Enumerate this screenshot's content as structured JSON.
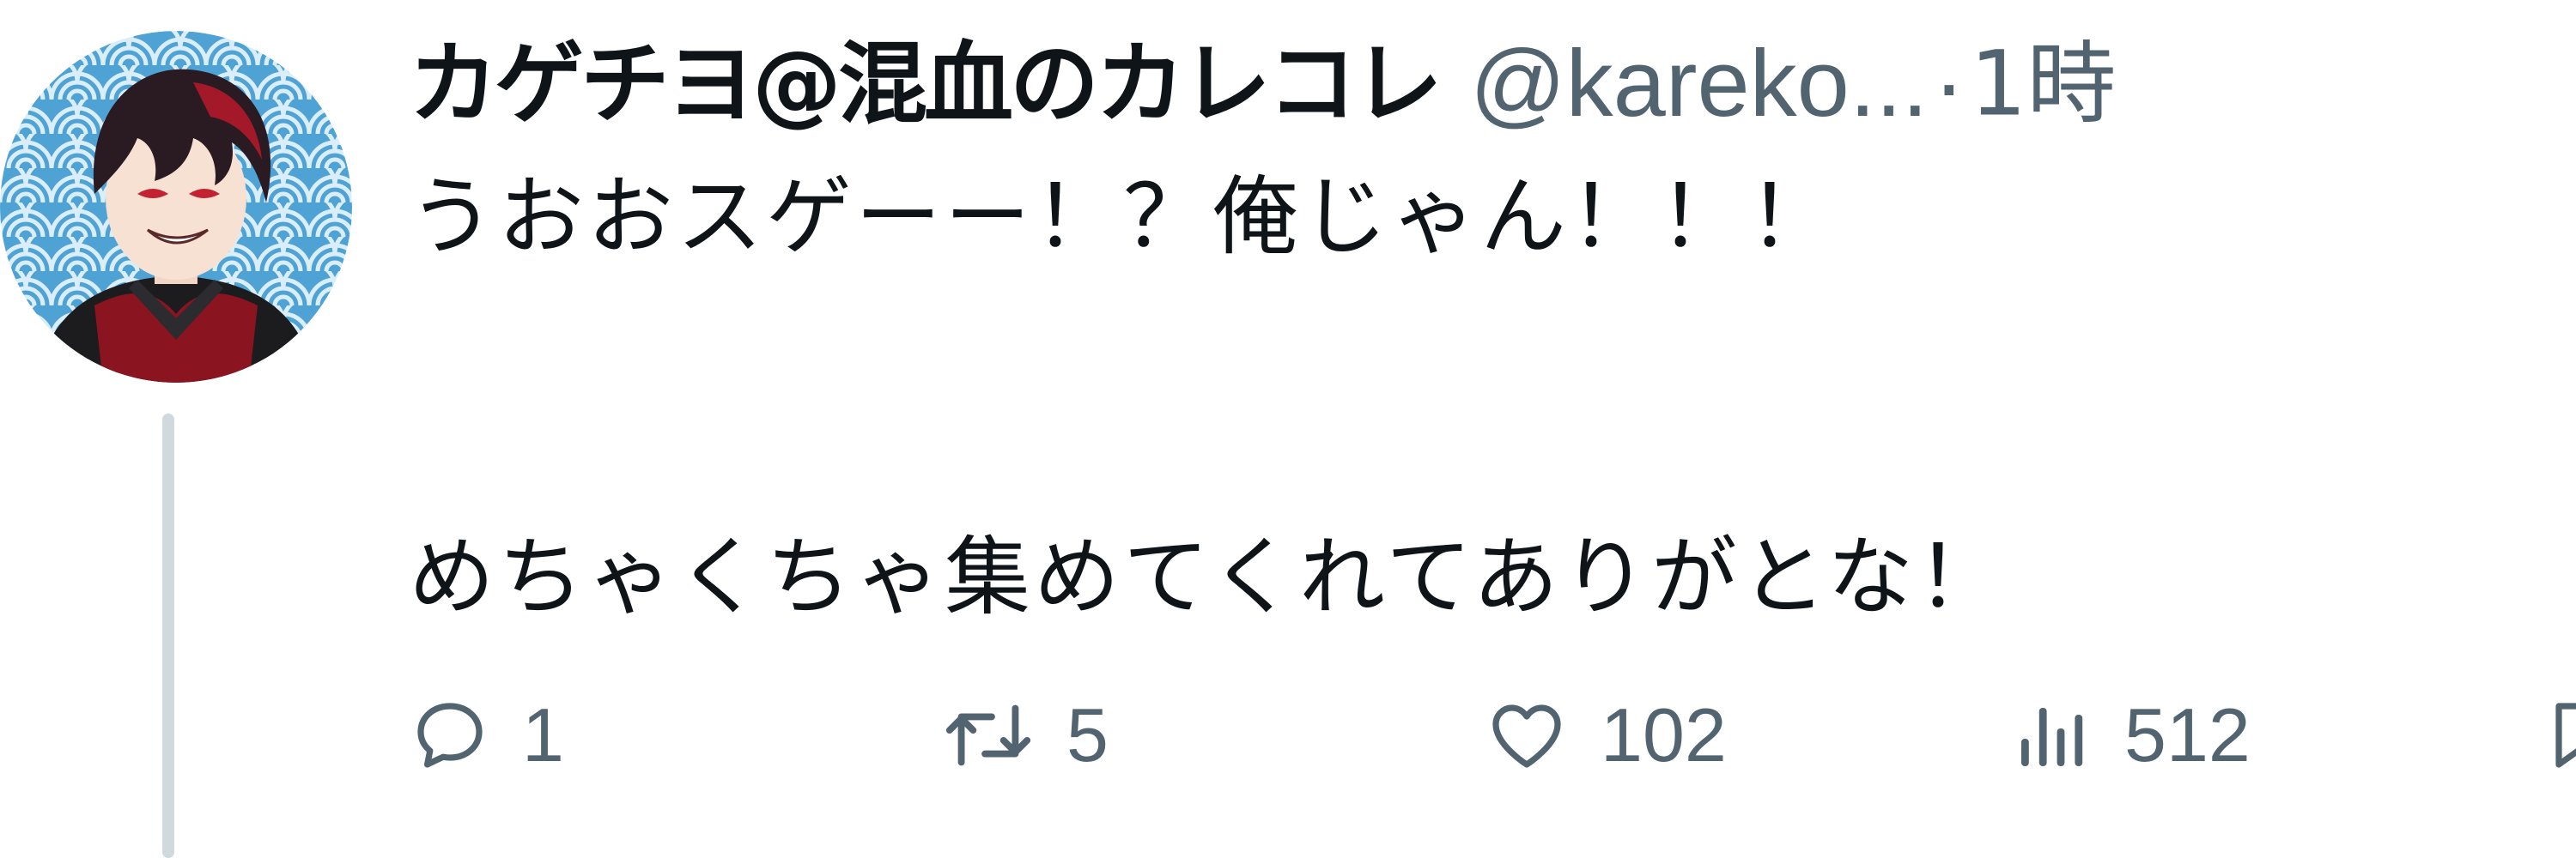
{
  "tweet": {
    "author": {
      "display_name": "カゲチヨ@混血のカレコレ",
      "handle": "@kareko...",
      "avatar_icon": "avatar-anime-character"
    },
    "separator": "·",
    "timestamp": "1時",
    "text_lines": [
      "うおおスゲーー！？俺じゃん！！！",
      "めちゃくちゃ集めてくれてありがとな！"
    ]
  },
  "actions": {
    "reply": {
      "icon": "reply-icon",
      "count": "1"
    },
    "retweet": {
      "icon": "retweet-icon",
      "count": "5"
    },
    "like": {
      "icon": "heart-icon",
      "count": "102"
    },
    "views": {
      "icon": "views-icon",
      "count": "512"
    },
    "bookmark": {
      "icon": "bookmark-icon"
    }
  },
  "colors": {
    "text_primary": "#0f1419",
    "text_secondary": "#536471",
    "thread_line": "#cfd9de",
    "avatar_bg": "#5aa9d6"
  }
}
